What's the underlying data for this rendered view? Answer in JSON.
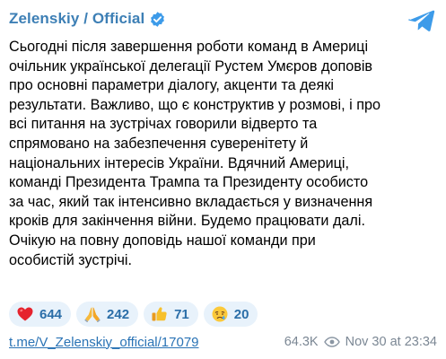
{
  "channel": {
    "name": "Zelenskiy / Official",
    "verified_icon": "verified-badge-icon",
    "share_icon": "telegram-share-icon"
  },
  "post": {
    "lines": [
      "Сьогодні після завершення роботи команд в Америці",
      "очільник української делегації Рустем Умєров доповів",
      "про основні параметри діалогу, акценти та деякі",
      "результати. Важливо, що є конструктив у розмові, і про",
      "всі питання на зустрічах говорили відверто та",
      "спрямовано на забезпечення суверенітету й",
      "національних інтересів України. Вдячний Америці,",
      "команді Президента Трампа та Президенту особисто",
      "за час, який так інтенсивно вкладається у визначення",
      "кроків для закінчення війни. Будемо працювати далі.",
      "Очікую на повну доповідь нашої команди при",
      "особистій зустрічі."
    ]
  },
  "reactions": [
    {
      "icon": "red-heart-icon",
      "count": "644"
    },
    {
      "icon": "folded-hands-icon",
      "count": "242"
    },
    {
      "icon": "thumbs-up-icon",
      "count": "71"
    },
    {
      "icon": "crying-face-icon",
      "count": "20"
    }
  ],
  "footer": {
    "link": "t.me/V_Zelenskiy_official/17079",
    "views": "64.3K",
    "views_icon": "eye-icon",
    "date": "Nov 30 at 23:34"
  },
  "colors": {
    "accent": "#3d7fb5",
    "link": "#2a73b5",
    "reaction_bg": "#e8f2fb"
  }
}
